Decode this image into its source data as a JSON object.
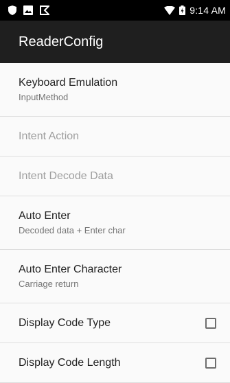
{
  "status_bar": {
    "time": "9:14 AM",
    "left_icons": [
      "shield-icon",
      "image-icon",
      "notification-flag-icon"
    ],
    "right_icons": [
      "wifi-icon",
      "battery-charging-icon"
    ]
  },
  "app_bar": {
    "title": "ReaderConfig"
  },
  "preferences": [
    {
      "title": "Keyboard Emulation",
      "summary": "InputMethod",
      "enabled": true
    },
    {
      "title": "Intent Action",
      "enabled": false
    },
    {
      "title": "Intent Decode Data",
      "enabled": false
    },
    {
      "title": "Auto Enter",
      "summary": "Decoded data + Enter char",
      "enabled": true
    },
    {
      "title": "Auto Enter Character",
      "summary": "Carriage return",
      "enabled": true
    },
    {
      "title": "Display Code Type",
      "checkbox": false,
      "enabled": true
    },
    {
      "title": "Display Code Length",
      "checkbox": false,
      "enabled": true
    }
  ]
}
